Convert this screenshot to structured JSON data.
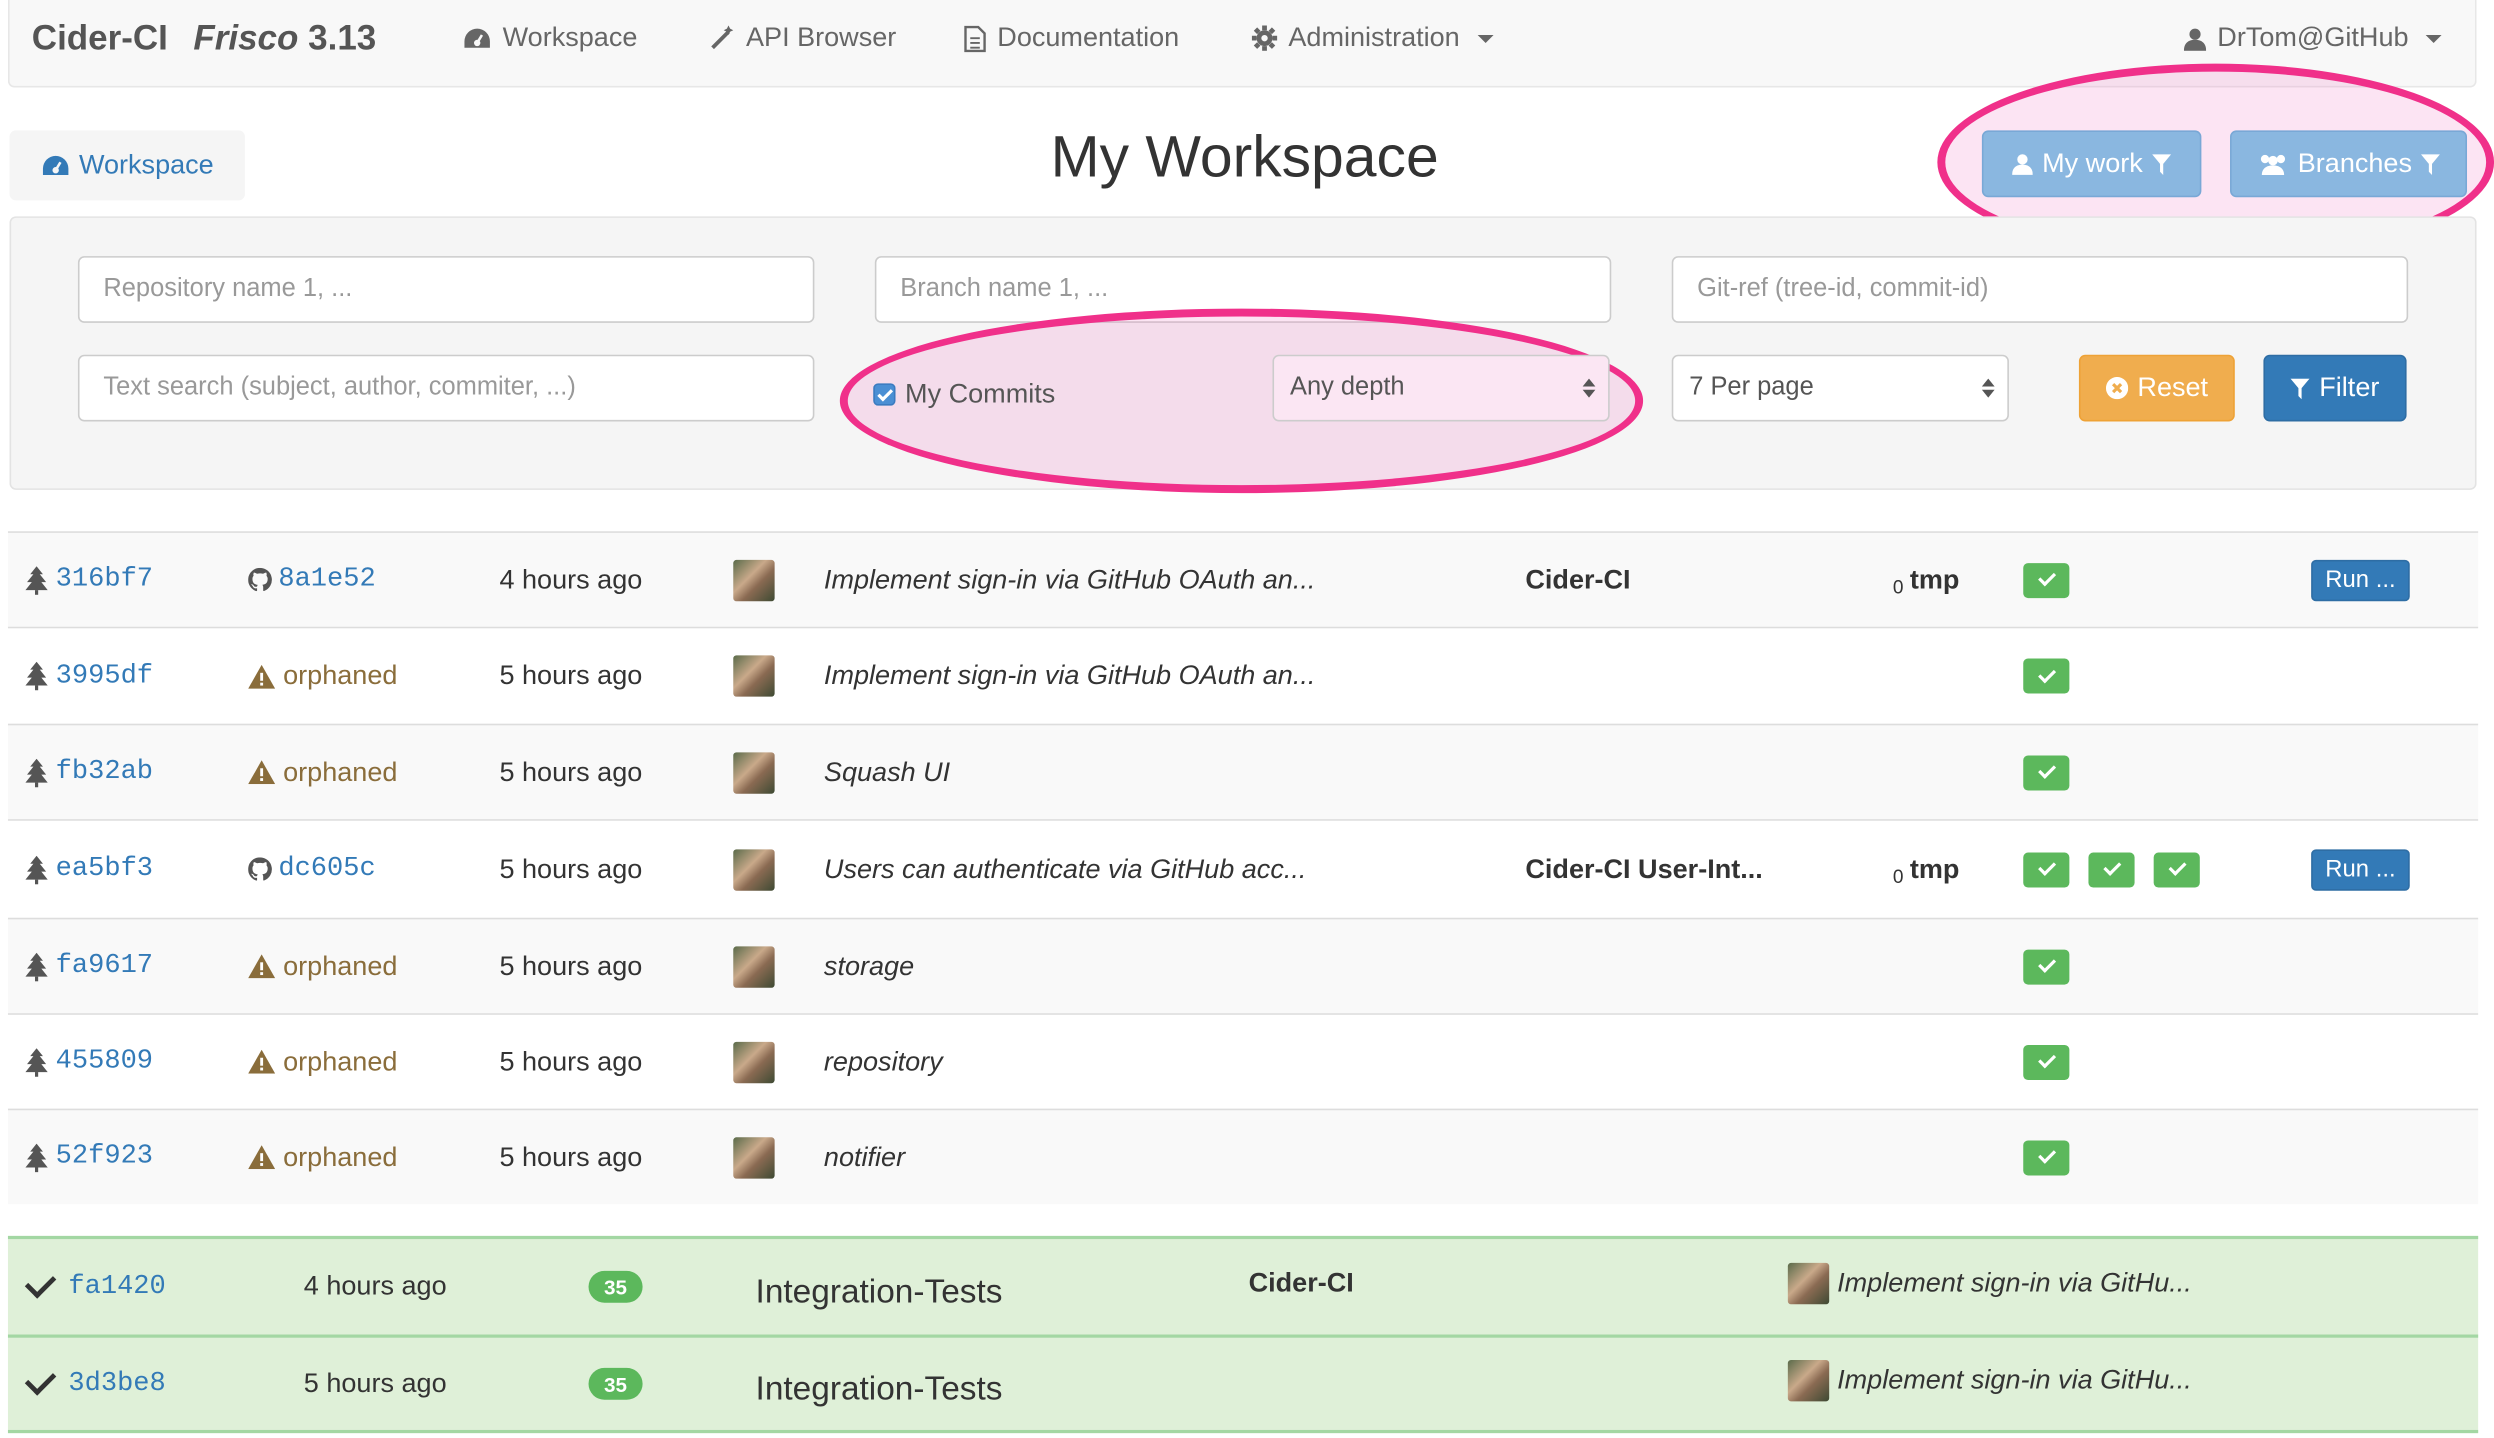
{
  "navbar": {
    "brand": "Cider-CI",
    "version_name": "Frisco",
    "version_number": "3.13",
    "items": [
      {
        "label": "Workspace",
        "icon": "dashboard-icon"
      },
      {
        "label": "API Browser",
        "icon": "magic-wand-icon"
      },
      {
        "label": "Documentation",
        "icon": "file-icon"
      },
      {
        "label": "Administration",
        "icon": "gear-icon"
      }
    ],
    "user": "DrTom@GitHub"
  },
  "breadcrumb": {
    "label": "Workspace"
  },
  "page": {
    "title": "My Workspace"
  },
  "header_buttons": {
    "my_work": "My work",
    "branches": "Branches"
  },
  "filters": {
    "repository_placeholder": "Repository name 1, ...",
    "branch_placeholder": "Branch name 1, ...",
    "gitref_placeholder": "Git-ref (tree-id, commit-id)",
    "text_search_placeholder": "Text search (subject, author, commiter, ...)",
    "my_commits_label": "My Commits",
    "my_commits_checked": true,
    "depth_value": "Any depth",
    "per_page_value": "7 Per page",
    "reset_label": "Reset",
    "filter_label": "Filter"
  },
  "commits": [
    {
      "tree": "316bf7",
      "ref": "8a1e52",
      "ref_type": "github",
      "time": "4 hours ago",
      "subject": "Implement sign-in via GitHub OAuth an...",
      "repo": "Cider-CI",
      "depth": "0",
      "branch": "tmp",
      "passed": 1,
      "run": "Run ..."
    },
    {
      "tree": "3995df",
      "ref": "orphaned",
      "ref_type": "orphaned",
      "time": "5 hours ago",
      "subject": "Implement sign-in via GitHub OAuth an...",
      "repo": "",
      "depth": "",
      "branch": "",
      "passed": 1,
      "run": ""
    },
    {
      "tree": "fb32ab",
      "ref": "orphaned",
      "ref_type": "orphaned",
      "time": "5 hours ago",
      "subject": "Squash UI",
      "repo": "",
      "depth": "",
      "branch": "",
      "passed": 1,
      "run": ""
    },
    {
      "tree": "ea5bf3",
      "ref": "dc605c",
      "ref_type": "github",
      "time": "5 hours ago",
      "subject": "Users can authenticate via GitHub acc...",
      "repo": "Cider-CI User-Int...",
      "depth": "0",
      "branch": "tmp",
      "passed": 3,
      "run": "Run ..."
    },
    {
      "tree": "fa9617",
      "ref": "orphaned",
      "ref_type": "orphaned",
      "time": "5 hours ago",
      "subject": "storage",
      "repo": "",
      "depth": "",
      "branch": "",
      "passed": 1,
      "run": ""
    },
    {
      "tree": "455809",
      "ref": "orphaned",
      "ref_type": "orphaned",
      "time": "5 hours ago",
      "subject": "repository",
      "repo": "",
      "depth": "",
      "branch": "",
      "passed": 1,
      "run": ""
    },
    {
      "tree": "52f923",
      "ref": "orphaned",
      "ref_type": "orphaned",
      "time": "5 hours ago",
      "subject": "notifier",
      "repo": "",
      "depth": "",
      "branch": "",
      "passed": 1,
      "run": ""
    }
  ],
  "jobs": [
    {
      "tree": "fa1420",
      "time": "4 hours ago",
      "count": "35",
      "name": "Integration-Tests",
      "repo": "Cider-CI",
      "subject": "Implement sign-in via GitHu..."
    },
    {
      "tree": "3d3be8",
      "time": "5 hours ago",
      "count": "35",
      "name": "Integration-Tests",
      "repo": "",
      "subject": "Implement sign-in via GitHu..."
    }
  ],
  "colors": {
    "primary": "#337ab7",
    "success": "#5cb85c",
    "warning": "#f0ad4e",
    "highlight": "#f0308a"
  }
}
